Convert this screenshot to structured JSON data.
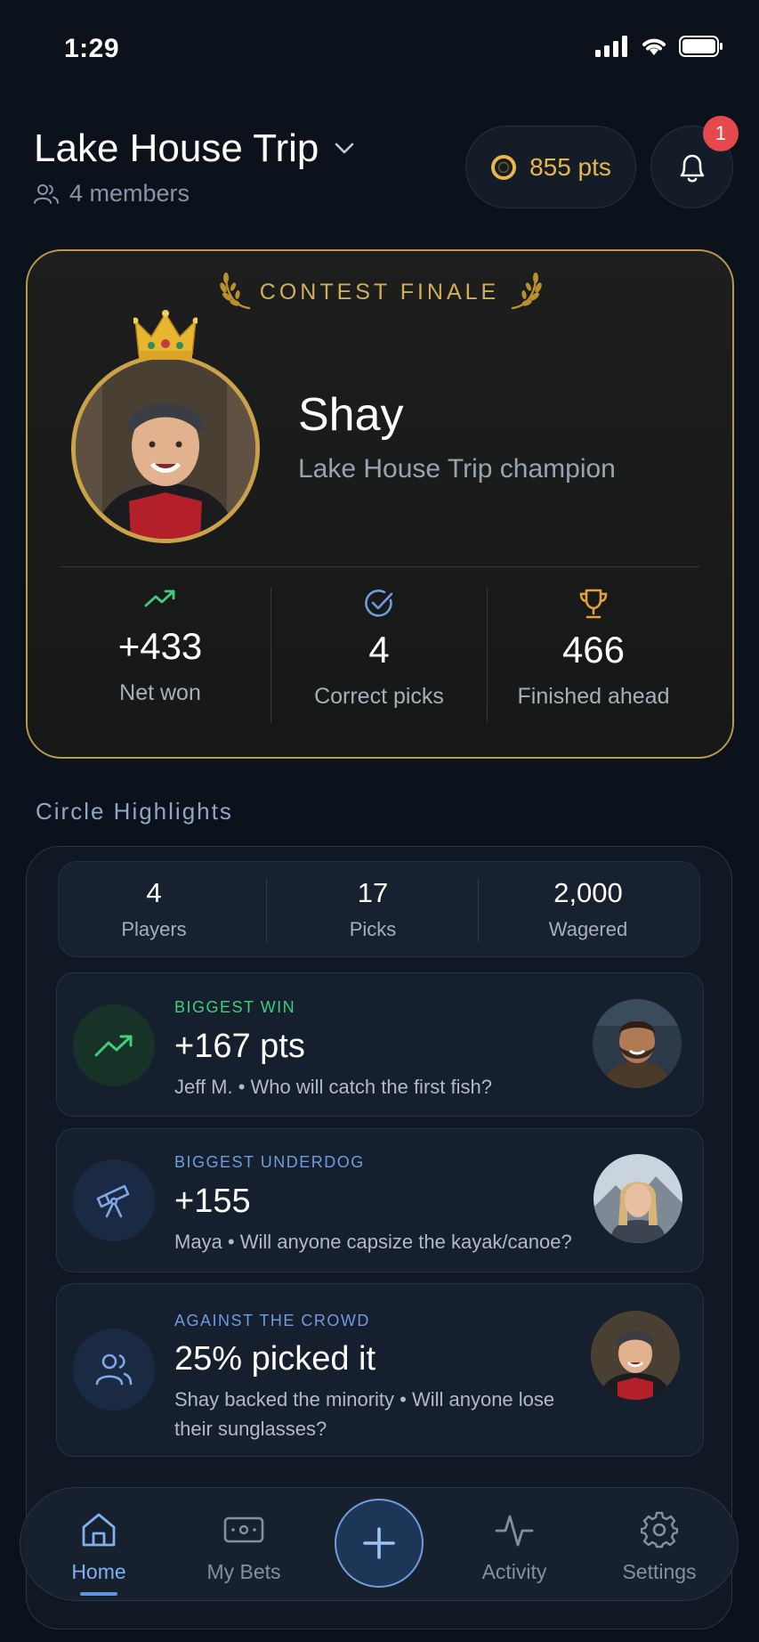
{
  "status_bar": {
    "time": "1:29"
  },
  "header": {
    "circle_name": "Lake House Trip",
    "members_label": "4 members",
    "points_label": "855 pts",
    "notification_count": "1"
  },
  "finale": {
    "title": "CONTEST FINALE",
    "champion_name": "Shay",
    "champion_subtitle": "Lake House Trip champion",
    "stats": [
      {
        "value": "+433",
        "label": "Net won",
        "icon": "trending-up-icon",
        "color": "#3ecf7c"
      },
      {
        "value": "4",
        "label": "Correct picks",
        "icon": "check-circle-icon",
        "color": "#6f9be0"
      },
      {
        "value": "466",
        "label": "Finished ahead",
        "icon": "trophy-icon",
        "color": "#e0a43a"
      }
    ]
  },
  "highlights": {
    "section_title": "Circle Highlights",
    "summary": [
      {
        "value": "4",
        "label": "Players"
      },
      {
        "value": "17",
        "label": "Picks"
      },
      {
        "value": "2,000",
        "label": "Wagered"
      }
    ],
    "items": [
      {
        "kicker": "BIGGEST WIN",
        "value": "+167 pts",
        "description": "Jeff M. • Who will catch the first fish?",
        "kicker_color": "#3ecf7c",
        "icon": "trending-up-icon"
      },
      {
        "kicker": "BIGGEST UNDERDOG",
        "value": "+155",
        "description": "Maya • Will anyone capsize the kayak/canoe?",
        "kicker_color": "#6f9be0",
        "icon": "telescope-icon"
      },
      {
        "kicker": "AGAINST THE CROWD",
        "value": "25% picked it",
        "description": "Shay backed the minority • Will anyone lose their sunglasses?",
        "kicker_color": "#6f9be0",
        "icon": "users-icon"
      }
    ]
  },
  "nav": {
    "items": [
      {
        "label": "Home",
        "icon": "home-icon",
        "active": true
      },
      {
        "label": "My Bets",
        "icon": "ticket-icon",
        "active": false
      },
      {
        "label": "Activity",
        "icon": "activity-icon",
        "active": false
      },
      {
        "label": "Settings",
        "icon": "gear-icon",
        "active": false
      }
    ],
    "add_icon": "plus-icon"
  },
  "colors": {
    "background": "#0c121c",
    "gold": "#d4ad58",
    "accent_blue": "#6f9be0",
    "positive_green": "#3ecf7c",
    "badge_red": "#e5484d"
  }
}
